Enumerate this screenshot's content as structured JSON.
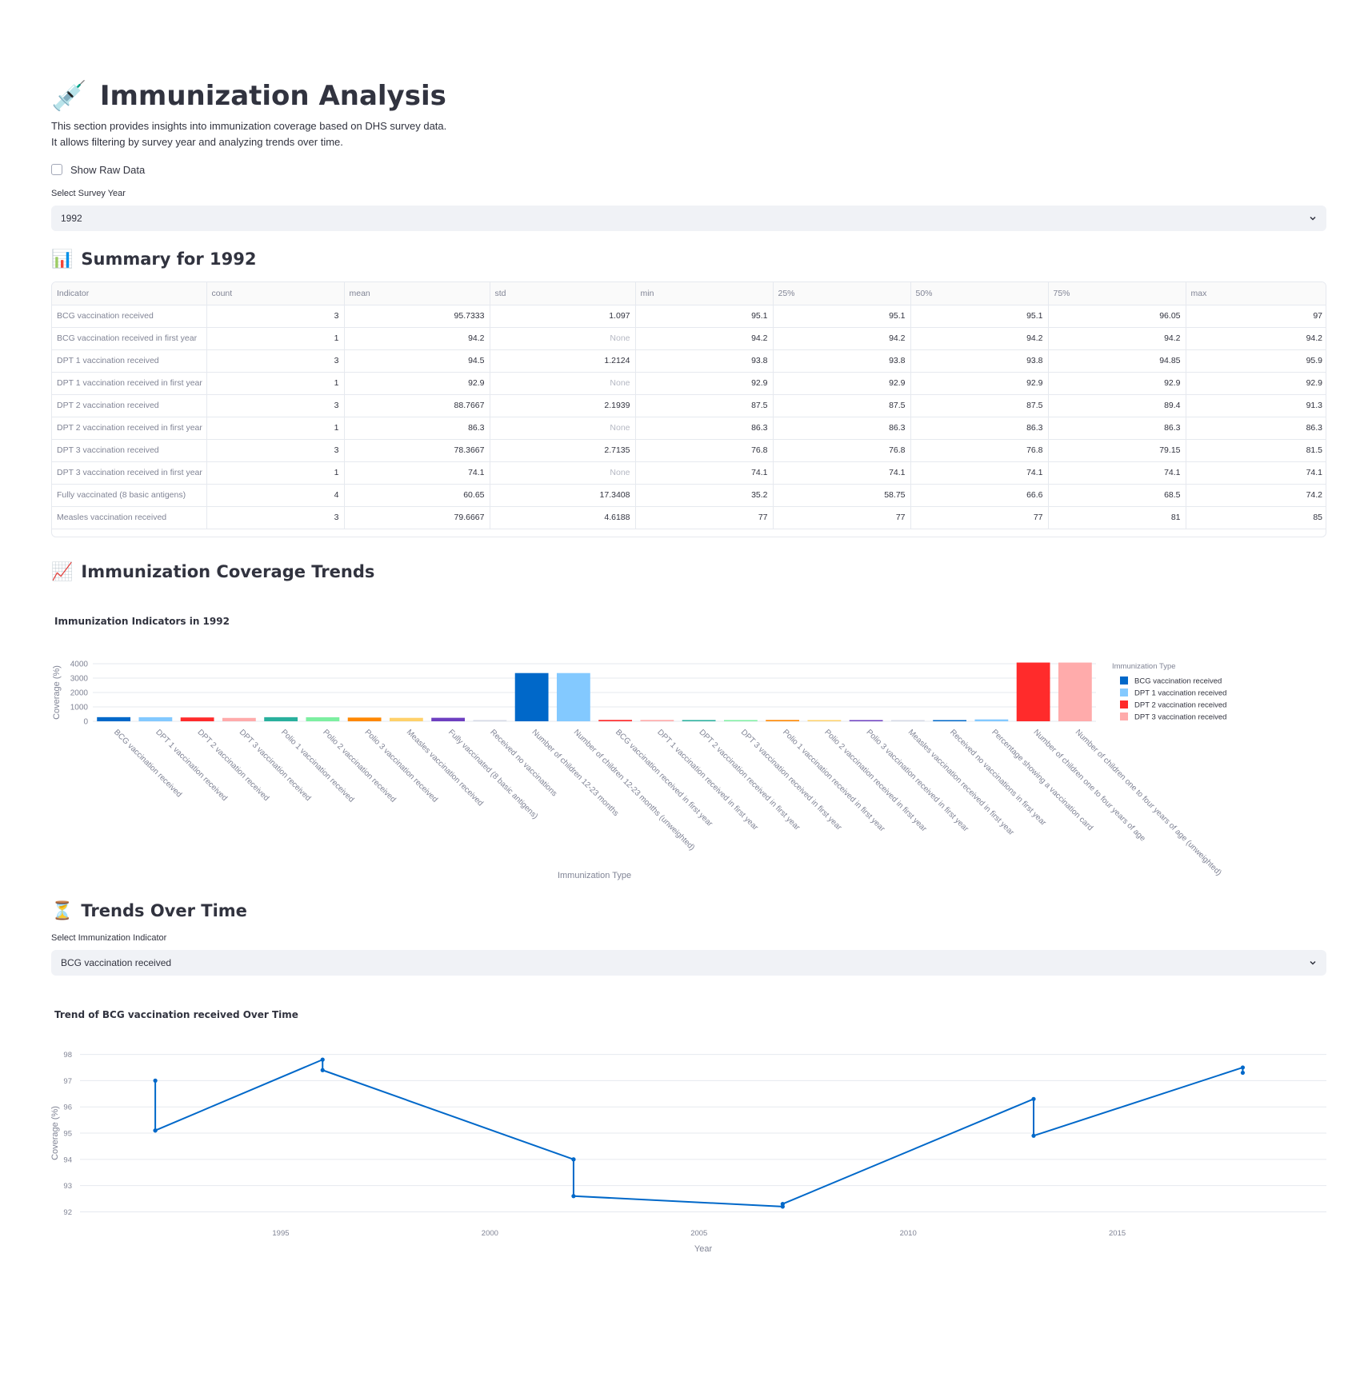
{
  "page": {
    "emoji": "💉",
    "title": "Immunization Analysis",
    "intro_line1": "This section provides insights into immunization coverage based on DHS survey data.",
    "intro_line2": "It allows filtering by survey year and analyzing trends over time."
  },
  "show_raw": {
    "label": "Show Raw Data",
    "checked": false
  },
  "year_select": {
    "label": "Select Survey Year",
    "value": "1992"
  },
  "summary": {
    "emoji": "📊",
    "title": "Summary for 1992",
    "columns": [
      "Indicator",
      "count",
      "mean",
      "std",
      "min",
      "25%",
      "50%",
      "75%",
      "max"
    ],
    "rows": [
      [
        "BCG vaccination received",
        "3",
        "95.7333",
        "1.097",
        "95.1",
        "95.1",
        "95.1",
        "96.05",
        "97"
      ],
      [
        "BCG vaccination received in first year",
        "1",
        "94.2",
        "None",
        "94.2",
        "94.2",
        "94.2",
        "94.2",
        "94.2"
      ],
      [
        "DPT 1 vaccination received",
        "3",
        "94.5",
        "1.2124",
        "93.8",
        "93.8",
        "93.8",
        "94.85",
        "95.9"
      ],
      [
        "DPT 1 vaccination received in first year",
        "1",
        "92.9",
        "None",
        "92.9",
        "92.9",
        "92.9",
        "92.9",
        "92.9"
      ],
      [
        "DPT 2 vaccination received",
        "3",
        "88.7667",
        "2.1939",
        "87.5",
        "87.5",
        "87.5",
        "89.4",
        "91.3"
      ],
      [
        "DPT 2 vaccination received in first year",
        "1",
        "86.3",
        "None",
        "86.3",
        "86.3",
        "86.3",
        "86.3",
        "86.3"
      ],
      [
        "DPT 3 vaccination received",
        "3",
        "78.3667",
        "2.7135",
        "76.8",
        "76.8",
        "76.8",
        "79.15",
        "81.5"
      ],
      [
        "DPT 3 vaccination received in first year",
        "1",
        "74.1",
        "None",
        "74.1",
        "74.1",
        "74.1",
        "74.1",
        "74.1"
      ],
      [
        "Fully vaccinated (8 basic antigens)",
        "4",
        "60.65",
        "17.3408",
        "35.2",
        "58.75",
        "66.6",
        "68.5",
        "74.2"
      ],
      [
        "Measles vaccination received",
        "3",
        "79.6667",
        "4.6188",
        "77",
        "77",
        "77",
        "81",
        "85"
      ]
    ]
  },
  "coverage": {
    "emoji": "📈",
    "title": "Immunization Coverage Trends"
  },
  "trends": {
    "emoji": "⏳",
    "title": "Trends Over Time"
  },
  "indicator_select": {
    "label": "Select Immunization Indicator",
    "value": "BCG vaccination received"
  },
  "chart_data": [
    {
      "type": "bar",
      "title": "Immunization Indicators in 1992",
      "xlabel": "Immunization Type",
      "ylabel": "Coverage (%)",
      "ylim": [
        0,
        4000
      ],
      "yticks": [
        0,
        1000,
        2000,
        3000,
        4000
      ],
      "grid": true,
      "legend_title": "Immunization Type",
      "legend_position": "top-right",
      "legend": [
        {
          "name": "BCG vaccination received",
          "color": "#0068c9"
        },
        {
          "name": "DPT 1 vaccination received",
          "color": "#83c9ff"
        },
        {
          "name": "DPT 2 vaccination received",
          "color": "#ff2b2b"
        },
        {
          "name": "DPT 3 vaccination received",
          "color": "#ffabab"
        }
      ],
      "categories": [
        "BCG vaccination received",
        "DPT 1 vaccination received",
        "DPT 2 vaccination received",
        "DPT 3 vaccination received",
        "Polio 1 vaccination received",
        "Polio 2 vaccination received",
        "Polio 3 vaccination received",
        "Measles vaccination received",
        "Fully vaccinated (8 basic antigens)",
        "Received no vaccinations",
        "Number of children 12-23 months",
        "Number of children 12-23 months (unweighted)",
        "BCG vaccination received in first year",
        "DPT 1 vaccination received in first year",
        "DPT 2 vaccination received in first year",
        "DPT 3 vaccination received in first year",
        "Polio 1 vaccination received in first year",
        "Polio 2 vaccination received in first year",
        "Polio 3 vaccination received in first year",
        "Measles vaccination received in first year",
        "Received no vaccinations in first year",
        "Percentage showing a vaccination card",
        "Number of children one to four years of age",
        "Number of children one to four years of age (unweighted)"
      ],
      "values": [
        287,
        284,
        266,
        235,
        285,
        280,
        258,
        239,
        243,
        12,
        3350,
        3350,
        94,
        93,
        86,
        74,
        90,
        84,
        72,
        62,
        14,
        130,
        4080,
        4080
      ],
      "colors": [
        "#0068c9",
        "#83c9ff",
        "#ff2b2b",
        "#ffabab",
        "#29b09d",
        "#7defa1",
        "#ff8700",
        "#ffd16a",
        "#6d3fc0",
        "#d5dae5",
        "#0068c9",
        "#83c9ff",
        "#ff2b2b",
        "#ffabab",
        "#29b09d",
        "#7defa1",
        "#ff8700",
        "#ffd16a",
        "#6d3fc0",
        "#d5dae5",
        "#0068c9",
        "#83c9ff",
        "#ff2b2b",
        "#ffabab"
      ]
    },
    {
      "type": "line",
      "title": "Trend of BCG vaccination received Over Time",
      "xlabel": "Year",
      "ylabel": "Coverage (%)",
      "xlim": [
        1990.2,
        2020
      ],
      "ylim": [
        91.8,
        98.2
      ],
      "xticks": [
        1995,
        2000,
        2005,
        2010,
        2015
      ],
      "yticks": [
        92,
        93,
        94,
        95,
        96,
        97,
        98
      ],
      "grid": true,
      "color": "#0068c9",
      "x": [
        1992,
        1992,
        1992,
        1996,
        1996,
        2002,
        2002,
        2002,
        2007,
        2007,
        2013,
        2013,
        2018,
        2018
      ],
      "y": [
        97.0,
        95.1,
        95.1,
        97.8,
        97.4,
        94.0,
        94.0,
        92.6,
        92.2,
        92.3,
        96.3,
        94.9,
        97.5,
        97.3
      ]
    }
  ]
}
